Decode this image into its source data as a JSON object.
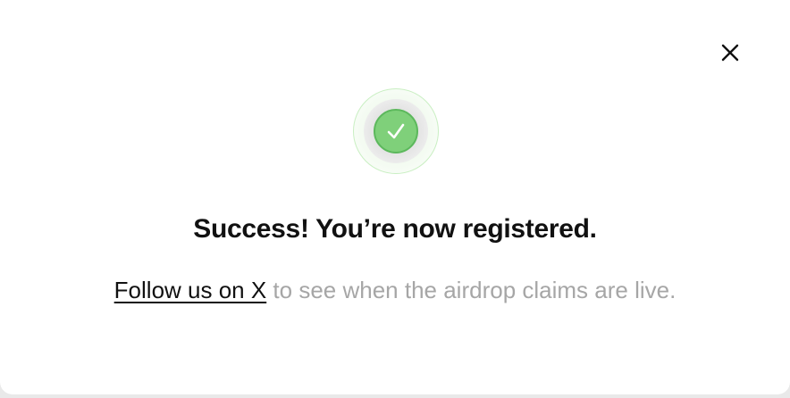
{
  "dialog": {
    "title": "Success! You’re now registered.",
    "follow_link_label": "Follow us on X",
    "follow_suffix": " to see when the airdrop claims are live.",
    "close_icon": "close-icon",
    "status_icon": "checkmark-icon"
  },
  "colors": {
    "success_green": "#7fd07a",
    "success_border": "#5cb85c",
    "text_primary": "#111111",
    "text_muted": "#a6a6a6"
  }
}
